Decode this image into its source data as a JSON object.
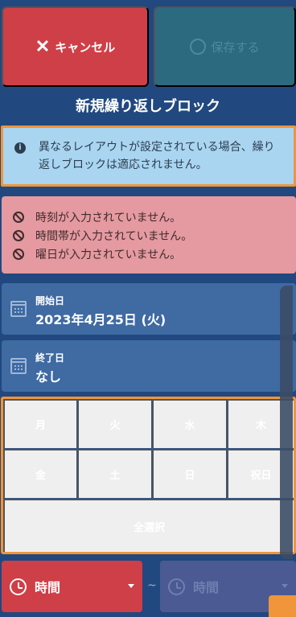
{
  "toolbar": {
    "cancel_label": "キャンセル",
    "save_label": "保存する"
  },
  "header": {
    "title": "新規繰り返しブロック"
  },
  "info": {
    "message": "異なるレイアウトが設定されている場合、繰り返しブロックは適応されません。"
  },
  "errors": [
    "時刻が入力されていません。",
    "時間帯が入力されていません。",
    "曜日が入力されていません。"
  ],
  "dates": {
    "start_label": "開始日",
    "start_value": "2023年4月25日 (火)",
    "end_label": "終了日",
    "end_value": "なし"
  },
  "weekdays": [
    "月",
    "火",
    "水",
    "木",
    "金",
    "土",
    "日",
    "祝日"
  ],
  "select_all_label": "全選択",
  "time": {
    "start_placeholder": "時間",
    "separator": "~",
    "end_placeholder": "時間"
  },
  "colors": {
    "background": "#21487f",
    "cancel": "#cf3f47",
    "save": "#2c6a7f",
    "info": "#a9d5f1",
    "error": "#e49aa0",
    "card": "#3f6aa2",
    "highlight": "#f0953a"
  },
  "icons": {
    "cancel": "close-icon",
    "save": "circle-icon",
    "info": "info-icon",
    "error": "ban-icon",
    "date": "calendar-icon",
    "time": "clock-icon",
    "dropdown": "chevron-down-icon"
  }
}
